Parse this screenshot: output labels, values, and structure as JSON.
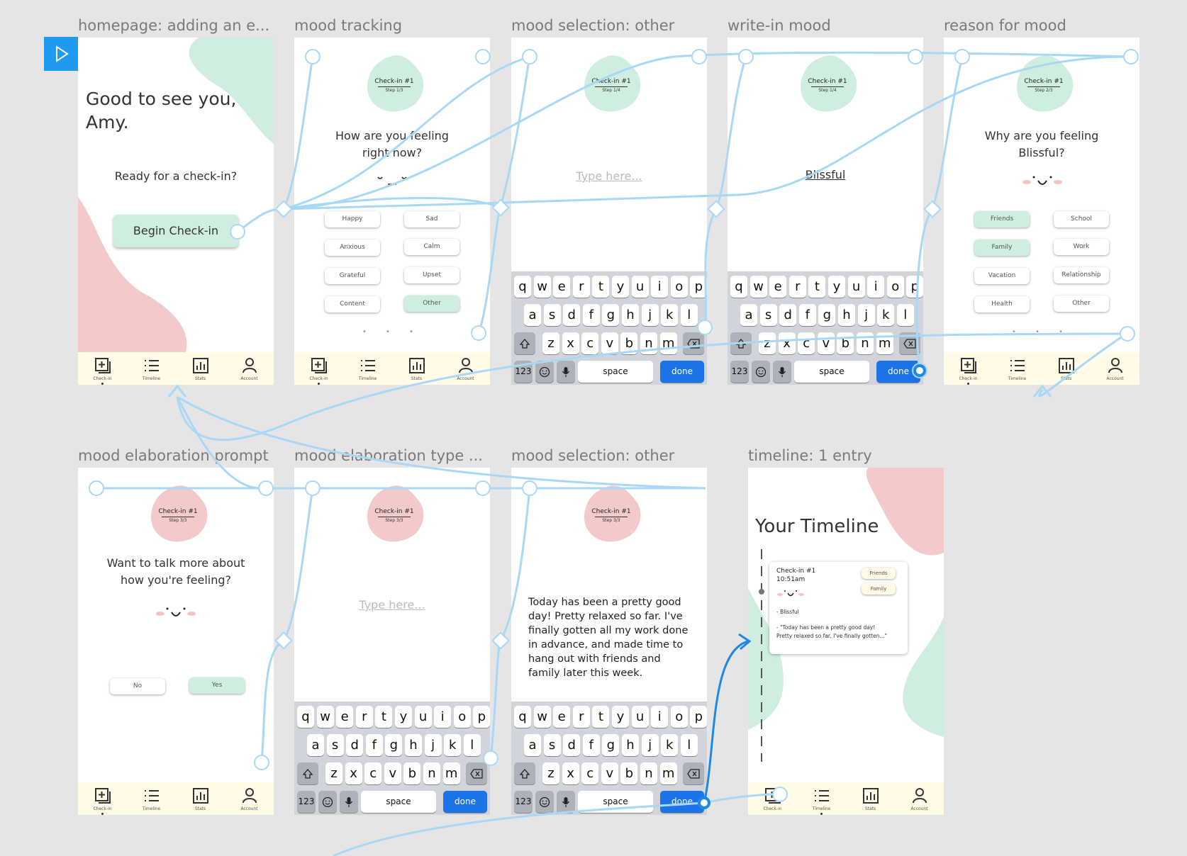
{
  "frames": [
    {
      "label": "homepage: adding an e...",
      "greeting_line1": "Good to see you,",
      "greeting_line2": "Amy.",
      "prompt": "Ready for a check-in?",
      "button": "Begin Check-in"
    },
    {
      "label": "mood tracking",
      "badge_title": "Check-in #1",
      "badge_step": "Step 1/3",
      "question_line1": "How are you feeling",
      "question_line2": "right now?",
      "moods": [
        "Happy",
        "Sad",
        "Anxious",
        "Calm",
        "Grateful",
        "Upset",
        "Content",
        "Other"
      ]
    },
    {
      "label": "mood selection: other",
      "badge_title": "Check-in #1",
      "badge_step": "Step 1/4",
      "placeholder": "Type here..."
    },
    {
      "label": "write-in mood",
      "badge_title": "Check-in #1",
      "badge_step": "Step 1/4",
      "written": "Blissful"
    },
    {
      "label": "reason for mood",
      "badge_title": "Check-in #1",
      "badge_step": "Step 2/3",
      "question_line1": "Why are you feeling",
      "question_line2": "Blissful?",
      "reasons": [
        "Friends",
        "School",
        "Family",
        "Work",
        "Vacation",
        "Relationship",
        "Health",
        "Other"
      ]
    },
    {
      "label": "mood elaboration prompt",
      "badge_title": "Check-in #1",
      "badge_step": "Step 3/3",
      "question_line1": "Want to talk more about",
      "question_line2": "how you're feeling?",
      "no": "No",
      "yes": "Yes"
    },
    {
      "label": "mood elaboration type ...",
      "badge_title": "Check-in #1",
      "badge_step": "Step 3/3",
      "placeholder": "Type here..."
    },
    {
      "label": "mood selection: other",
      "badge_title": "Check-in #1",
      "badge_step": "Step 3/3",
      "paragraph": "Today has been a pretty good day! Pretty relaxed so far. I've finally gotten all my work done in advance, and made time to hang out with friends and family later this week."
    },
    {
      "label": "timeline: 1 entry",
      "title": "Your Timeline",
      "entry_title": "Check-in #1",
      "entry_time": "10:51am",
      "tag1": "Friends",
      "tag2": "Family",
      "mood": "- Blissful",
      "quote_line1": "- \"Today has been a pretty good day!",
      "quote_line2": "Pretty relaxed so far. I've finally gotten...\""
    }
  ],
  "tabs": [
    "Check-in",
    "Timeline",
    "Stats",
    "Account"
  ],
  "keyboard": {
    "row1": [
      "q",
      "w",
      "e",
      "r",
      "t",
      "y",
      "u",
      "i",
      "o",
      "p"
    ],
    "row2": [
      "a",
      "s",
      "d",
      "f",
      "g",
      "h",
      "j",
      "k",
      "l"
    ],
    "row3": [
      "z",
      "x",
      "c",
      "v",
      "b",
      "n",
      "m"
    ],
    "numbers": "123",
    "space": "space",
    "done": "done"
  },
  "colors": {
    "mint": "#cfeee0",
    "pink": "#f3c9c9",
    "flow": "#a9d8f7",
    "tabbar": "#fffbe6",
    "done": "#1a74e8"
  },
  "icons": [
    "play-icon",
    "add-checkin-icon",
    "timeline-list-icon",
    "stats-chart-icon",
    "account-person-icon",
    "shift-icon",
    "backspace-icon",
    "emoji-icon",
    "mic-icon"
  ]
}
